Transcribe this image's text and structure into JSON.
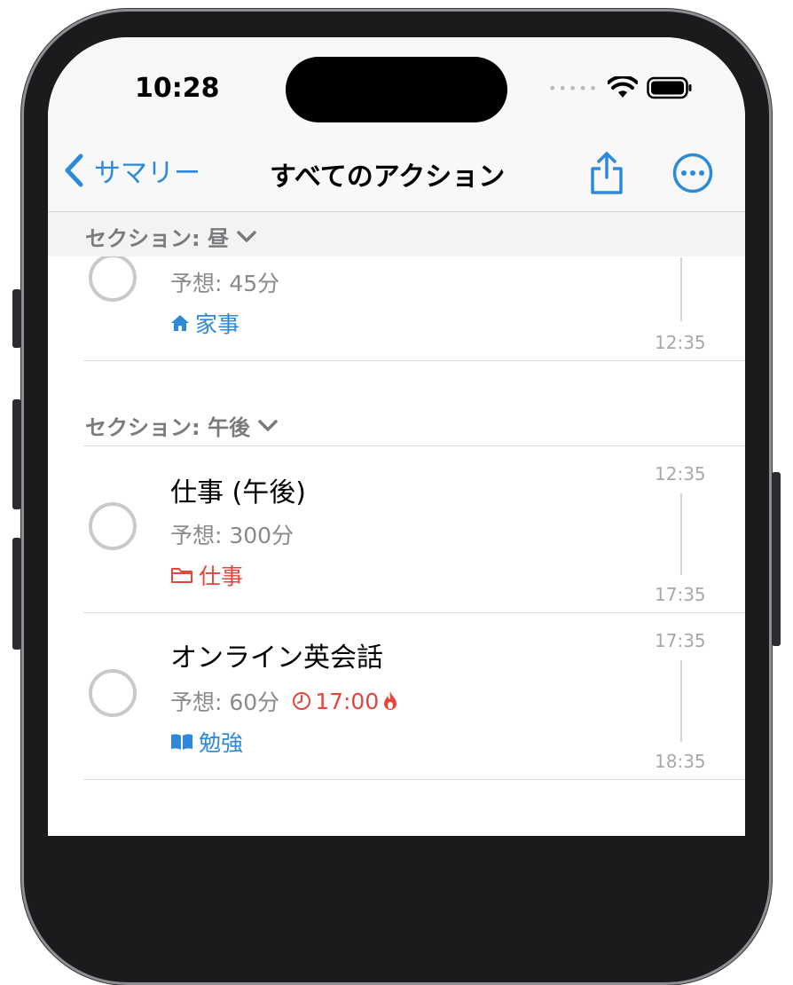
{
  "status_bar": {
    "time": "10:28"
  },
  "nav": {
    "back_label": "サマリー",
    "title": "すべてのアクション"
  },
  "sections": [
    {
      "label": "セクション: 昼"
    },
    {
      "label": "セクション: 午後"
    }
  ],
  "tasks": [
    {
      "estimate": "予想: 45分",
      "tag": "家事",
      "tag_icon": "house-icon",
      "tag_color": "#2d8ad8",
      "end_time": "12:35"
    },
    {
      "title": "仕事 (午後)",
      "estimate": "予想: 300分",
      "tag": "仕事",
      "tag_icon": "folder-icon",
      "tag_color": "#e5453b",
      "start_time": "12:35",
      "end_time": "17:35"
    },
    {
      "title": "オンライン英会話",
      "estimate": "予想: 60分",
      "deadline": "17:00",
      "tag": "勉強",
      "tag_icon": "book-icon",
      "tag_color": "#2d8ad8",
      "start_time": "17:35",
      "end_time": "18:35"
    }
  ]
}
